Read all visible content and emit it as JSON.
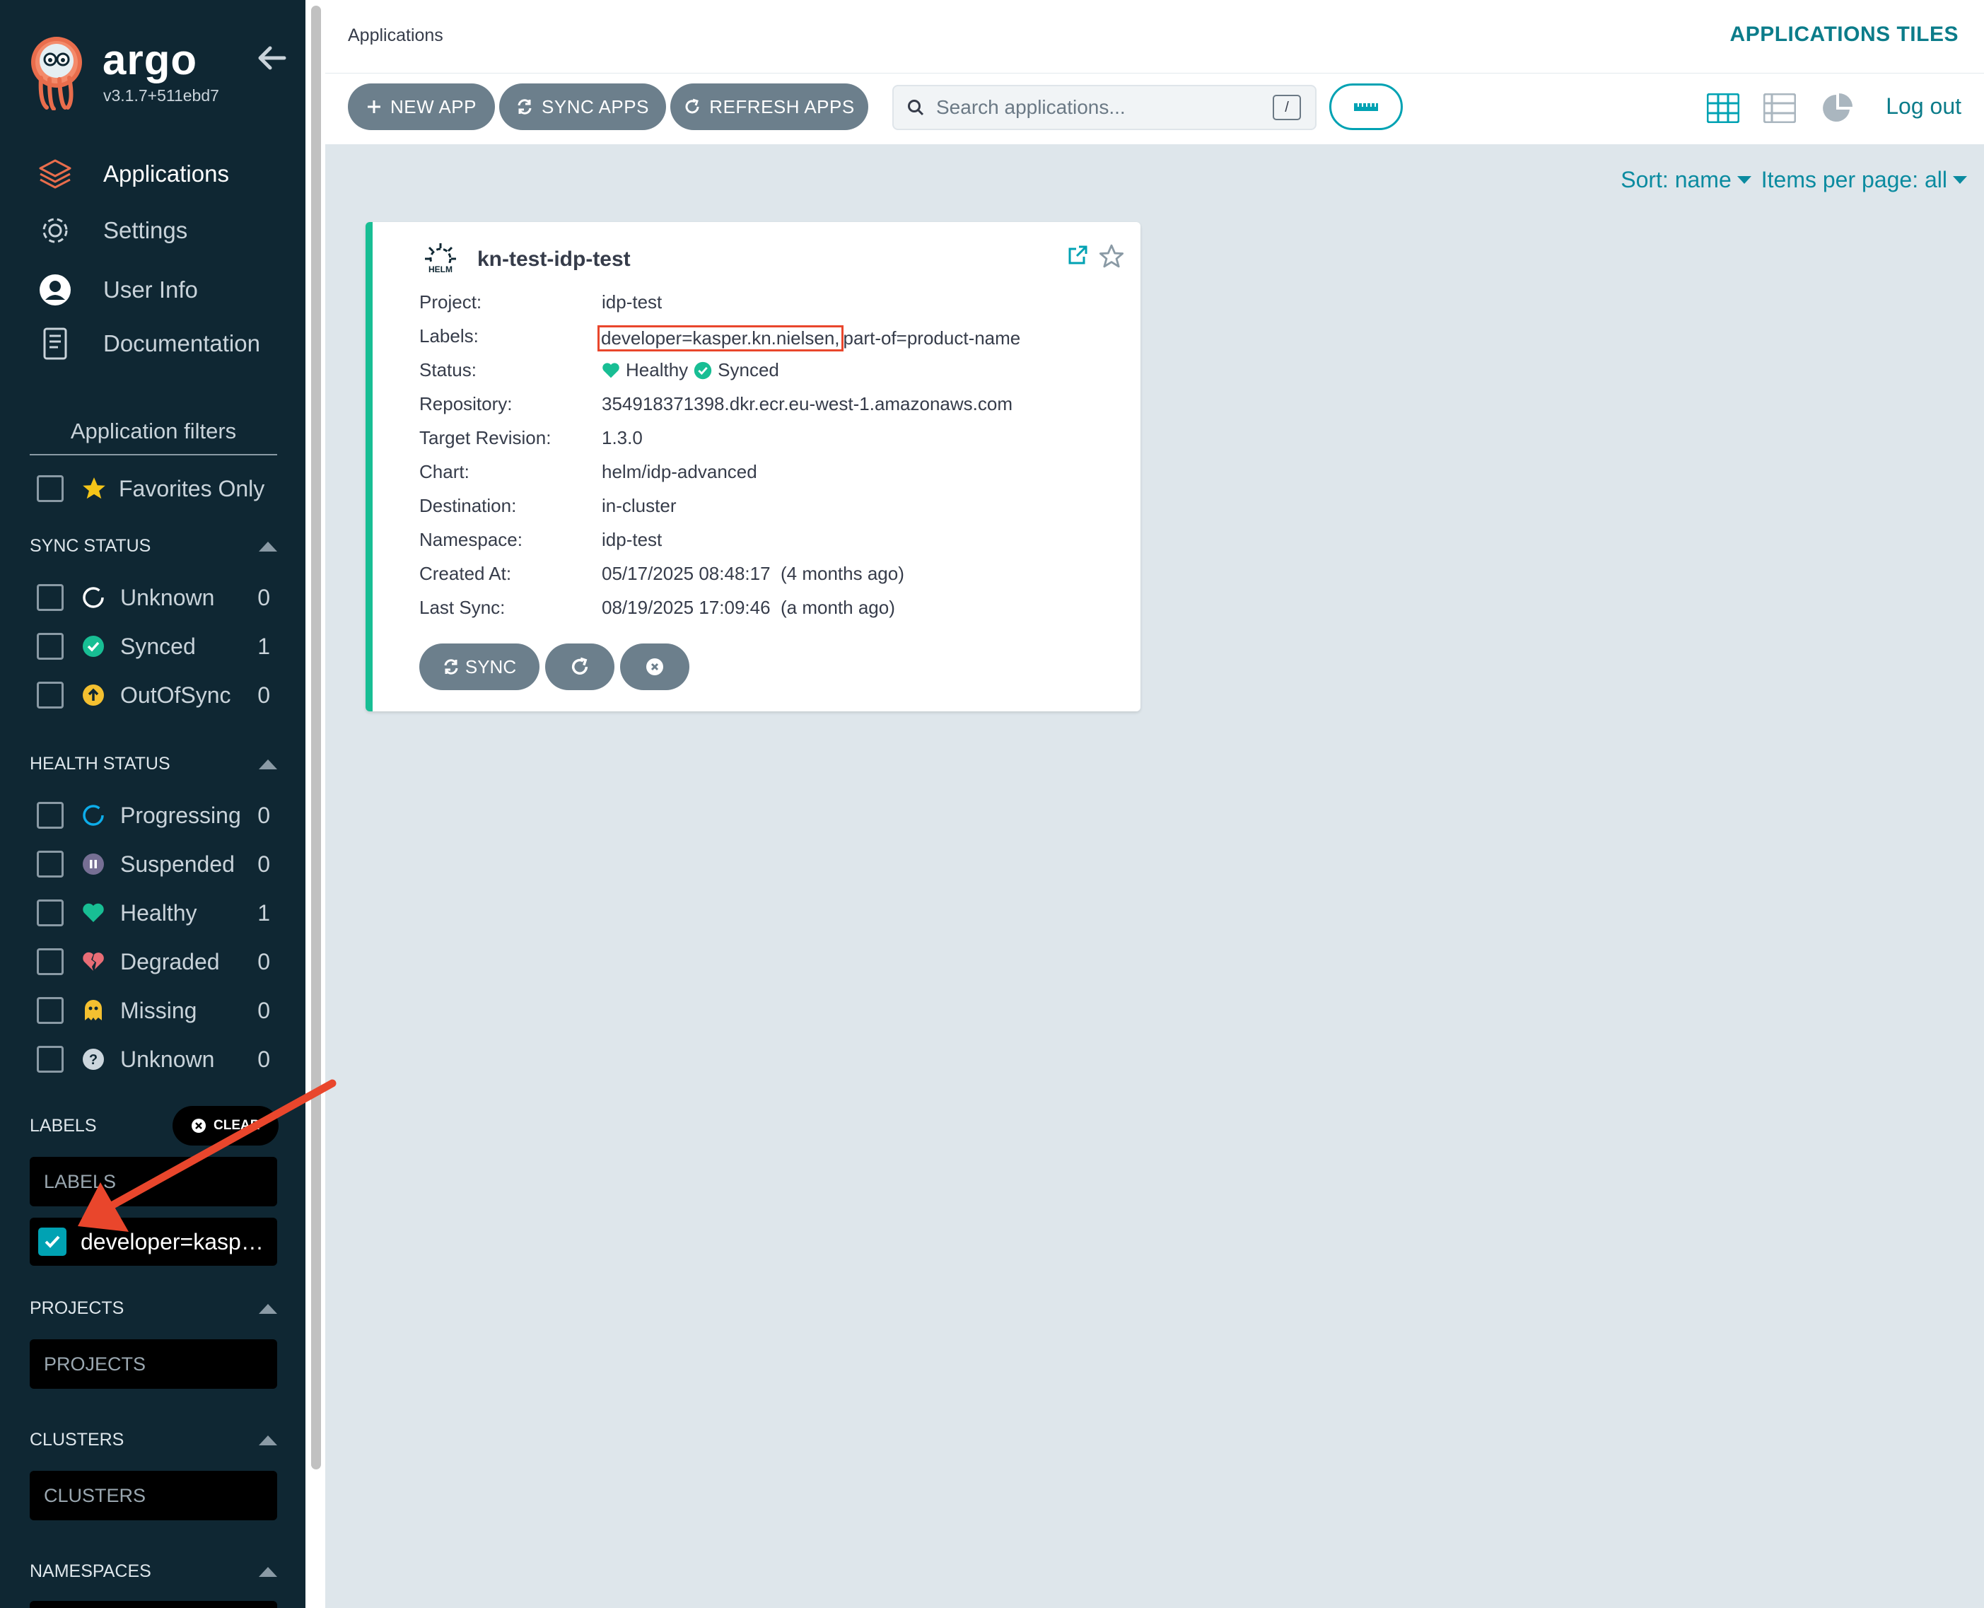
{
  "sidebar": {
    "brand": "argo",
    "version": "v3.1.7+511ebd7",
    "nav": [
      {
        "label": "Applications",
        "icon": "layers-icon",
        "active": true
      },
      {
        "label": "Settings",
        "icon": "gear-icon",
        "active": false
      },
      {
        "label": "User Info",
        "icon": "user-circle-icon",
        "active": false
      },
      {
        "label": "Documentation",
        "icon": "book-icon",
        "active": false
      }
    ],
    "filters_title": "Application filters",
    "favorites_label": "Favorites Only",
    "sync_status": {
      "heading": "SYNC STATUS",
      "items": [
        {
          "label": "Unknown",
          "count": "0",
          "icon": "circle-notch-icon"
        },
        {
          "label": "Synced",
          "count": "1",
          "icon": "check-circle-icon"
        },
        {
          "label": "OutOfSync",
          "count": "0",
          "icon": "arrow-up-circle-icon"
        }
      ]
    },
    "health_status": {
      "heading": "HEALTH STATUS",
      "items": [
        {
          "label": "Progressing",
          "count": "0",
          "icon": "progress-circle-icon"
        },
        {
          "label": "Suspended",
          "count": "0",
          "icon": "pause-circle-icon"
        },
        {
          "label": "Healthy",
          "count": "1",
          "icon": "heart-icon"
        },
        {
          "label": "Degraded",
          "count": "0",
          "icon": "heart-broken-icon"
        },
        {
          "label": "Missing",
          "count": "0",
          "icon": "ghost-icon"
        },
        {
          "label": "Unknown",
          "count": "0",
          "icon": "question-circle-icon"
        }
      ]
    },
    "labels": {
      "heading": "LABELS",
      "clear_label": "CLEAR",
      "placeholder": "LABELS",
      "selected": "developer=kasper.kn.nielsen"
    },
    "projects": {
      "heading": "PROJECTS",
      "placeholder": "PROJECTS"
    },
    "clusters": {
      "heading": "CLUSTERS",
      "placeholder": "CLUSTERS"
    },
    "namespaces": {
      "heading": "NAMESPACES"
    }
  },
  "topbar": {
    "title": "Applications",
    "view_title": "APPLICATIONS TILES"
  },
  "toolbar": {
    "new_app": "NEW APP",
    "sync_apps": "SYNC APPS",
    "refresh_apps": "REFRESH APPS",
    "search_placeholder": "Search applications...",
    "search_shortcut": "/",
    "logout": "Log out"
  },
  "sort": {
    "sort_label": "Sort: name",
    "per_page_label": "Items per page: all"
  },
  "app": {
    "name": "kn-test-idp-test",
    "props": [
      {
        "key": "Project:",
        "value": "idp-test"
      },
      {
        "key": "Labels:",
        "value": "developer=kasper.kn.nielsen,",
        "value2": "part-of=product-name"
      },
      {
        "key": "Status:",
        "health": "Healthy",
        "sync": "Synced"
      },
      {
        "key": "Repository:",
        "value": "354918371398.dkr.ecr.eu-west-1.amazonaws.com"
      },
      {
        "key": "Target Revision:",
        "value": "1.3.0"
      },
      {
        "key": "Chart:",
        "value": "helm/idp-advanced"
      },
      {
        "key": "Destination:",
        "value": "in-cluster"
      },
      {
        "key": "Namespace:",
        "value": "idp-test"
      },
      {
        "key": "Created At:",
        "value": "05/17/2025 08:48:17  (4 months ago)"
      },
      {
        "key": "Last Sync:",
        "value": "08/19/2025 17:09:46  (a month ago)"
      }
    ],
    "sync_button": "SYNC"
  },
  "colors": {
    "accent": "#00a2b3",
    "sidebar_bg": "#0f2733",
    "healthy": "#18be94",
    "highlight": "#e9462c"
  }
}
